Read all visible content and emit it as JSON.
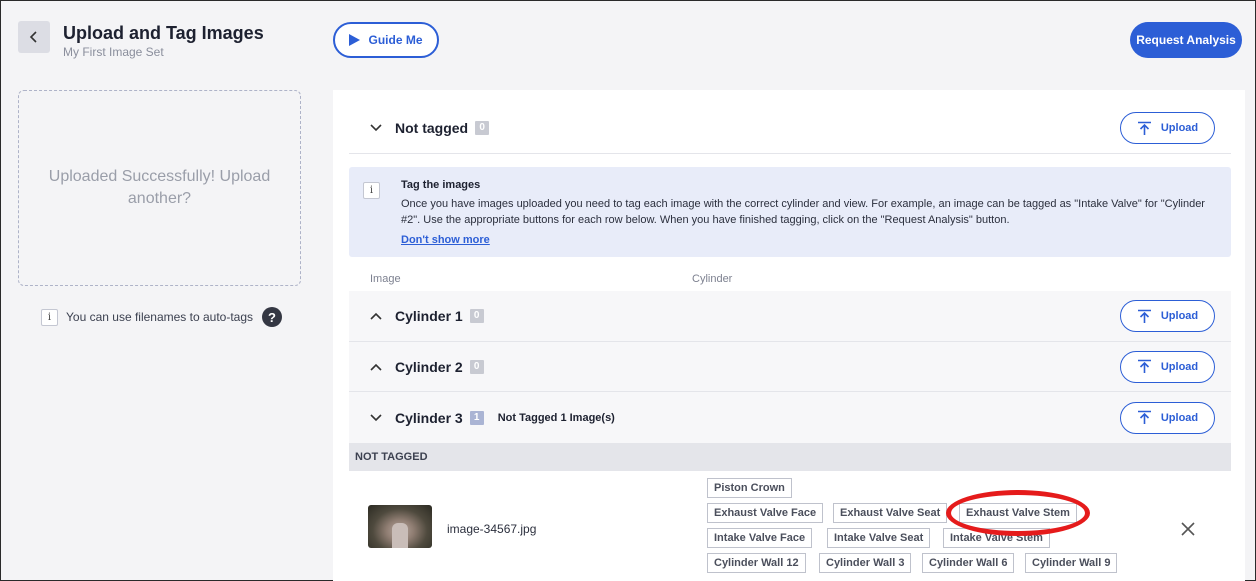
{
  "header": {
    "title": "Upload and Tag Images",
    "subtitle": "My First Image Set",
    "guide_label": "Guide Me",
    "request_label": "Request Analysis"
  },
  "sidebar": {
    "dropzone_text": "Uploaded Successfully! Upload another?",
    "auto_tag_text": "You can use filenames to auto-tags",
    "info_glyph": "i",
    "help_glyph": "?"
  },
  "sections": {
    "not_tagged": {
      "title": "Not tagged",
      "count": "0",
      "upload_label": "Upload"
    },
    "cylinder1": {
      "title": "Cylinder 1",
      "count": "0",
      "upload_label": "Upload"
    },
    "cylinder2": {
      "title": "Cylinder 2",
      "count": "0",
      "upload_label": "Upload"
    },
    "cylinder3": {
      "title": "Cylinder 3",
      "count": "1",
      "status": "Not Tagged 1 Image(s)",
      "upload_label": "Upload"
    }
  },
  "info_box": {
    "glyph": "i",
    "title": "Tag the images",
    "text": "Once you have images uploaded you need to tag each image with the correct cylinder and view. For example, an image can be tagged as \"Intake Valve\" for \"Cylinder #2\". Use the appropriate buttons for each row below. When you have finished tagging, click on the \"Request Analysis\" button.",
    "link": "Don't show more"
  },
  "columns": {
    "image": "Image",
    "cylinder": "Cylinder"
  },
  "not_tagged_bar": "NOT TAGGED",
  "image_row": {
    "filename": "image-34567.jpg",
    "tags": [
      "Piston Crown",
      "Exhaust Valve Face",
      "Exhaust Valve Seat",
      "Exhaust Valve Stem",
      "Intake Valve Face",
      "Intake Valve Seat",
      "Intake Valve Stem",
      "Cylinder Wall 12",
      "Cylinder Wall 3",
      "Cylinder Wall 6",
      "Cylinder Wall 9"
    ]
  },
  "colors": {
    "accent": "#2c5ed6",
    "highlight": "#e51b1b",
    "info_bg": "#e8ecf9"
  }
}
